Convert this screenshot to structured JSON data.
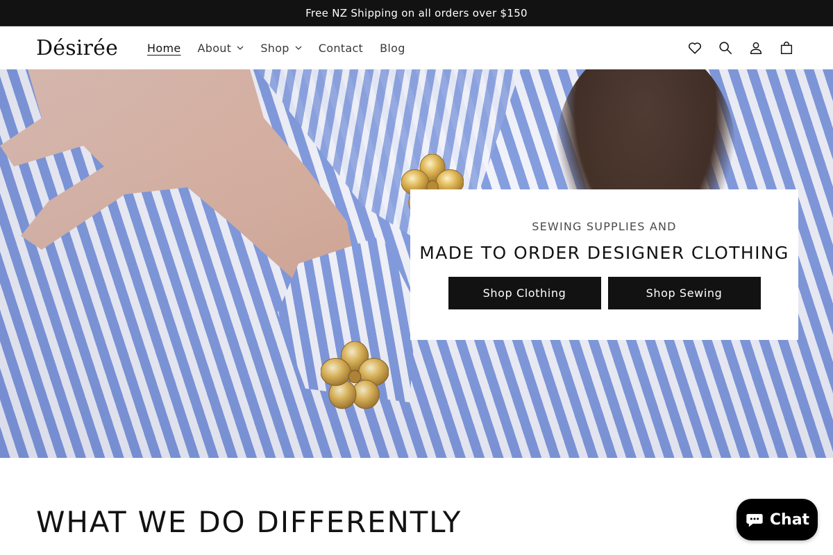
{
  "announcement": {
    "text": "Free NZ Shipping on all orders over $150"
  },
  "header": {
    "logo": "Désirée",
    "nav": [
      {
        "label": "Home",
        "active": true
      },
      {
        "label": "About",
        "dropdown": true
      },
      {
        "label": "Shop",
        "dropdown": true
      },
      {
        "label": "Contact"
      },
      {
        "label": "Blog"
      }
    ],
    "icons": [
      "heart-icon",
      "search-icon",
      "account-icon",
      "cart-icon"
    ]
  },
  "hero": {
    "subtitle": "SEWING SUPPLIES AND",
    "title": "MADE TO ORDER DESIGNER CLOTHING",
    "buttons": [
      {
        "label": "Shop Clothing"
      },
      {
        "label": "Shop Sewing"
      }
    ]
  },
  "section": {
    "title": "WHAT WE DO DIFFERENTLY"
  },
  "chat": {
    "label": "Chat"
  },
  "colors": {
    "announcement_bg": "#121212",
    "stripe_blue": "#7f99dd",
    "button_bg": "#121212",
    "chat_bg": "#000000"
  }
}
